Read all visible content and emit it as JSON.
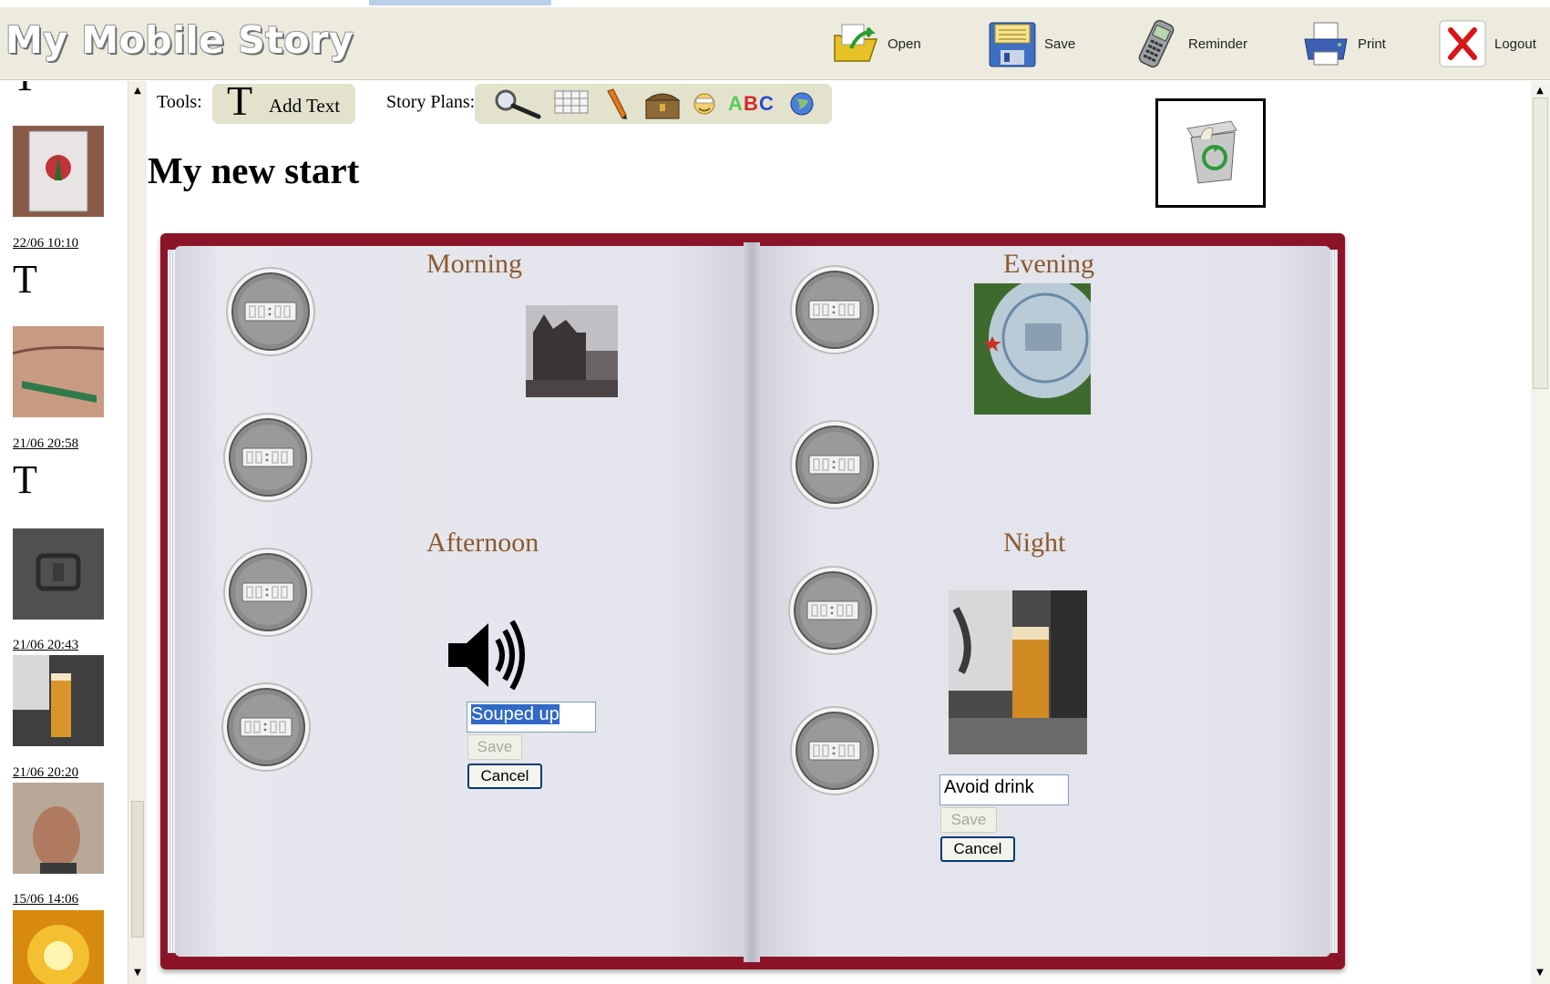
{
  "app": {
    "title": "My Mobile Story"
  },
  "toolbar": {
    "open_label": "Open",
    "save_label": "Save",
    "reminder_label": "Reminder",
    "print_label": "Print",
    "logout_label": "Logout"
  },
  "tools": {
    "label": "Tools:",
    "add_text_label": "Add Text",
    "story_plans_label": "Story Plans:"
  },
  "story": {
    "title": "My new start"
  },
  "sidebar": {
    "dates": [
      "22/06 10:10",
      "21/06 20:58",
      "21/06 20:43",
      "21/06 20:20",
      "15/06 14:06"
    ]
  },
  "book": {
    "morning": "Morning",
    "afternoon": "Afternoon",
    "evening": "Evening",
    "night": "Night",
    "afternoon_note": {
      "value": "Souped up",
      "save_label": "Save",
      "cancel_label": "Cancel"
    },
    "night_note": {
      "value": "Avoid drink",
      "save_label": "Save",
      "cancel_label": "Cancel"
    }
  },
  "icons": {
    "open": "folder-open-icon",
    "save": "floppy-disk-icon",
    "reminder": "mobile-phone-icon",
    "print": "printer-icon",
    "logout": "close-icon",
    "trash": "recycle-bin-icon",
    "sound": "speaker-icon"
  }
}
